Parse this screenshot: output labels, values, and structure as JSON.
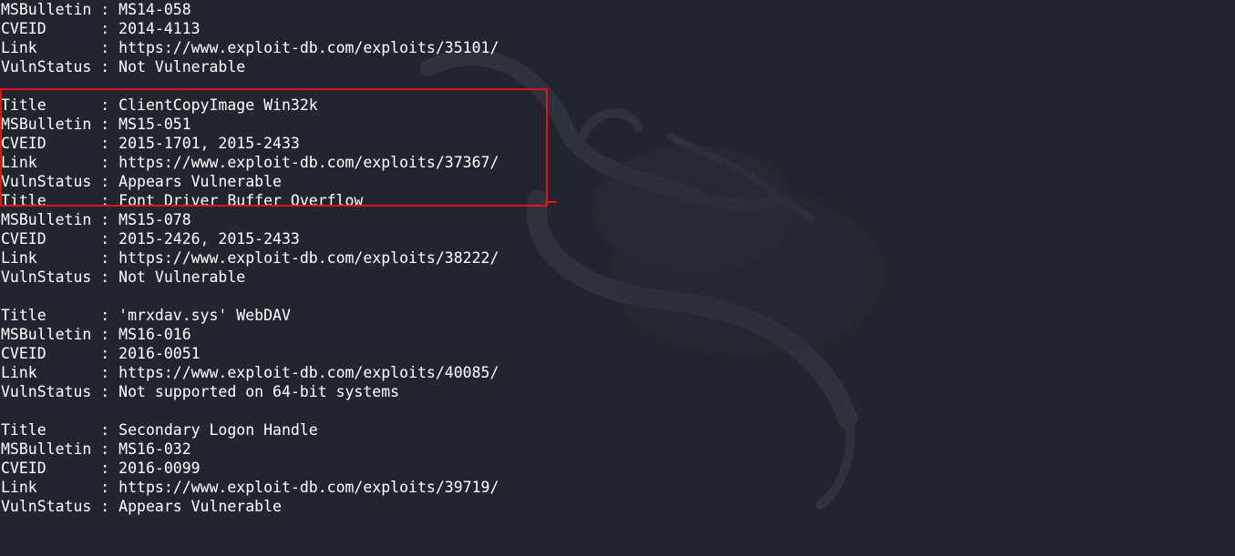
{
  "app": {
    "background_color": "#23252e",
    "text_color": "#ffffff",
    "highlight_color": "#e0121b",
    "watermark_icon": "kali-dragon-icon"
  },
  "sep": " : ",
  "partial_entry": {
    "rows": [
      {
        "key": "MSBulletin",
        "value": "MS14-058"
      },
      {
        "key": "CVEID     ",
        "value": "2014-4113"
      },
      {
        "key": "Link      ",
        "value": "https://www.exploit-db.com/exploits/35101/"
      },
      {
        "key": "VulnStatus",
        "value": "Not Vulnerable"
      }
    ]
  },
  "entries": [
    {
      "highlighted": true,
      "rows": [
        {
          "key": "Title     ",
          "value": "ClientCopyImage Win32k"
        },
        {
          "key": "MSBulletin",
          "value": "MS15-051"
        },
        {
          "key": "CVEID     ",
          "value": "2015-1701, 2015-2433"
        },
        {
          "key": "Link      ",
          "value": "https://www.exploit-db.com/exploits/37367/"
        },
        {
          "key": "VulnStatus",
          "value": "Appears Vulnerable"
        }
      ]
    },
    {
      "highlighted": false,
      "rows": [
        {
          "key": "Title     ",
          "value": "Font Driver Buffer Overflow"
        },
        {
          "key": "MSBulletin",
          "value": "MS15-078"
        },
        {
          "key": "CVEID     ",
          "value": "2015-2426, 2015-2433"
        },
        {
          "key": "Link      ",
          "value": "https://www.exploit-db.com/exploits/38222/"
        },
        {
          "key": "VulnStatus",
          "value": "Not Vulnerable"
        }
      ]
    },
    {
      "highlighted": false,
      "rows": [
        {
          "key": "Title     ",
          "value": "'mrxdav.sys' WebDAV"
        },
        {
          "key": "MSBulletin",
          "value": "MS16-016"
        },
        {
          "key": "CVEID     ",
          "value": "2016-0051"
        },
        {
          "key": "Link      ",
          "value": "https://www.exploit-db.com/exploits/40085/"
        },
        {
          "key": "VulnStatus",
          "value": "Not supported on 64-bit systems"
        }
      ]
    },
    {
      "highlighted": false,
      "rows": [
        {
          "key": "Title     ",
          "value": "Secondary Logon Handle"
        },
        {
          "key": "MSBulletin",
          "value": "MS16-032"
        },
        {
          "key": "CVEID     ",
          "value": "2016-0099"
        },
        {
          "key": "Link      ",
          "value": "https://www.exploit-db.com/exploits/39719/"
        },
        {
          "key": "VulnStatus",
          "value": "Appears Vulnerable"
        }
      ]
    }
  ]
}
